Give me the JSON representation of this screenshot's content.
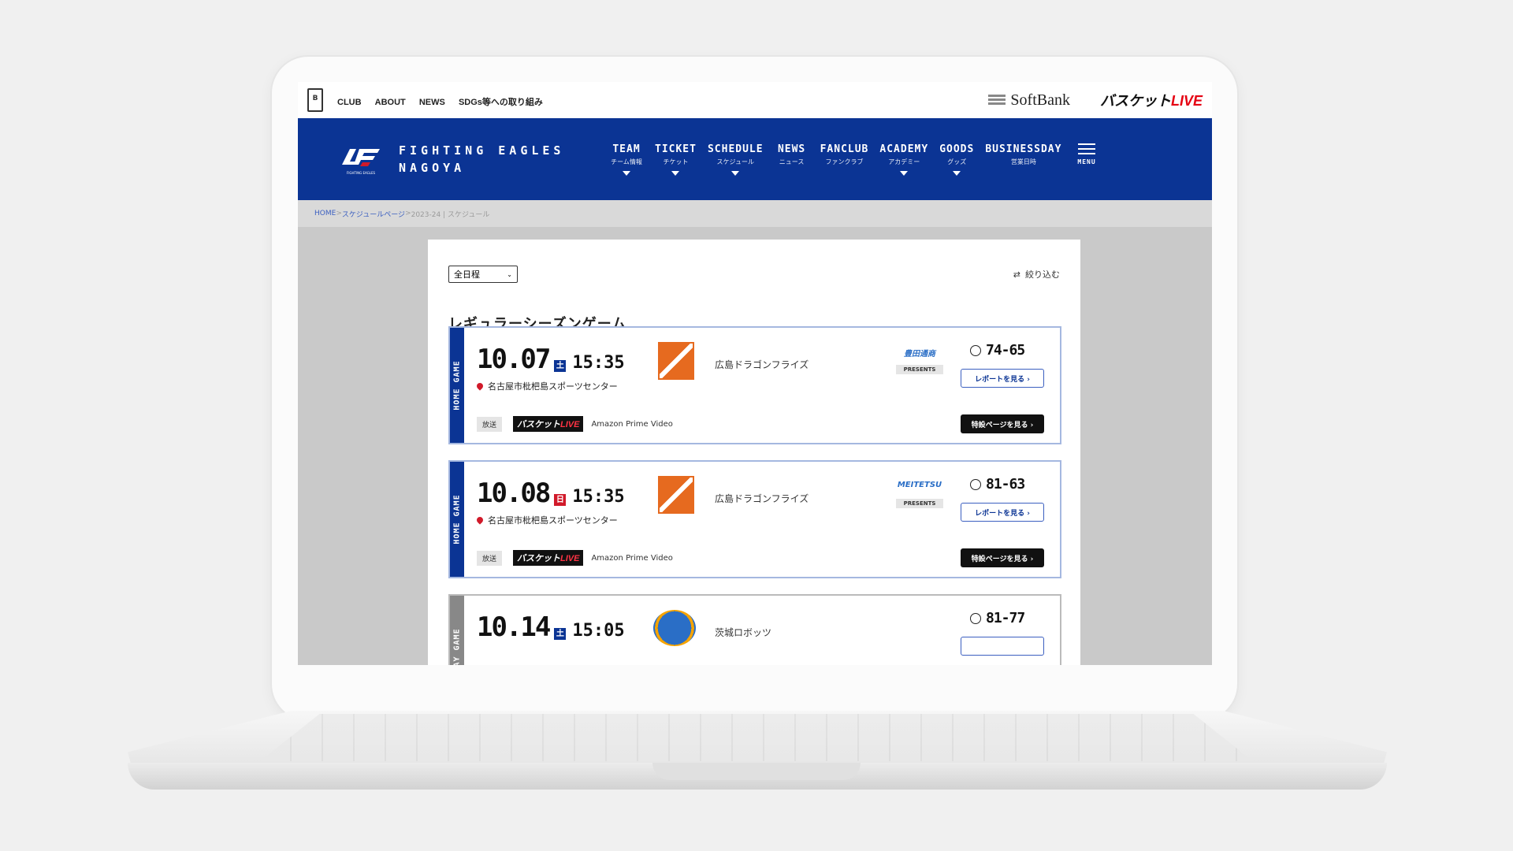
{
  "topbar": {
    "league_logo": "B",
    "links": [
      "CLUB",
      "ABOUT",
      "NEWS",
      "SDGs等への取り組み"
    ],
    "sponsor": "SoftBank",
    "basket_live_prefix": "バスケット",
    "basket_live_suffix": "LIVE"
  },
  "brand": {
    "line1": "FIGHTING EAGLES",
    "line2": "NAGOYA",
    "mark_caption": "FIGHTING EAGLES"
  },
  "nav": [
    {
      "en": "TEAM",
      "jp": "チーム情報",
      "has_caret": true
    },
    {
      "en": "TICKET",
      "jp": "チケット",
      "has_caret": true
    },
    {
      "en": "SCHEDULE",
      "jp": "スケジュール",
      "has_caret": true
    },
    {
      "en": "NEWS",
      "jp": "ニュース",
      "has_caret": false
    },
    {
      "en": "FANCLUB",
      "jp": "ファンクラブ",
      "has_caret": false
    },
    {
      "en": "ACADEMY",
      "jp": "アカデミー",
      "has_caret": true
    },
    {
      "en": "GOODS",
      "jp": "グッズ",
      "has_caret": true
    },
    {
      "en": "BUSINESSDAY",
      "jp": "営業日時",
      "has_caret": false
    }
  ],
  "nav_menu_label": "MENU",
  "breadcrumb": {
    "home": "HOME",
    "sep": " > ",
    "schedule": "スケジュールページ",
    "current": "2023-24 | スケジュール"
  },
  "filter": {
    "select_value": "全日程",
    "refine_label": "絞り込む"
  },
  "section_title": "レギュラーシーズンゲーム",
  "games": [
    {
      "side": "HOME GAME",
      "date": "10.07",
      "dow": "土",
      "time": "15:35",
      "venue": "名古屋市枇杷島スポーツセンター",
      "opponent": "広島ドラゴンフライズ",
      "sponsor": "豊田通商",
      "presents": "PRESENTS",
      "score": "74-65",
      "report_label": "レポートを見る ›",
      "broadcast_tag": "放送",
      "broadcast_service": "Amazon Prime Video",
      "special_label": "特設ページを見る ›"
    },
    {
      "side": "HOME GAME",
      "date": "10.08",
      "dow": "日",
      "time": "15:35",
      "venue": "名古屋市枇杷島スポーツセンター",
      "opponent": "広島ドラゴンフライズ",
      "sponsor": "MEITETSU",
      "presents": "PRESENTS",
      "score": "81-63",
      "report_label": "レポートを見る ›",
      "broadcast_tag": "放送",
      "broadcast_service": "Amazon Prime Video",
      "special_label": "特設ページを見る ›"
    },
    {
      "side": "AWAY GAME",
      "date": "10.14",
      "dow": "土",
      "time": "15:05",
      "opponent": "茨城ロボッツ",
      "score": "81-77"
    }
  ],
  "colors": {
    "nav_blue": "#0b3494",
    "red": "#d11a2a",
    "live_red": "#e50012"
  }
}
